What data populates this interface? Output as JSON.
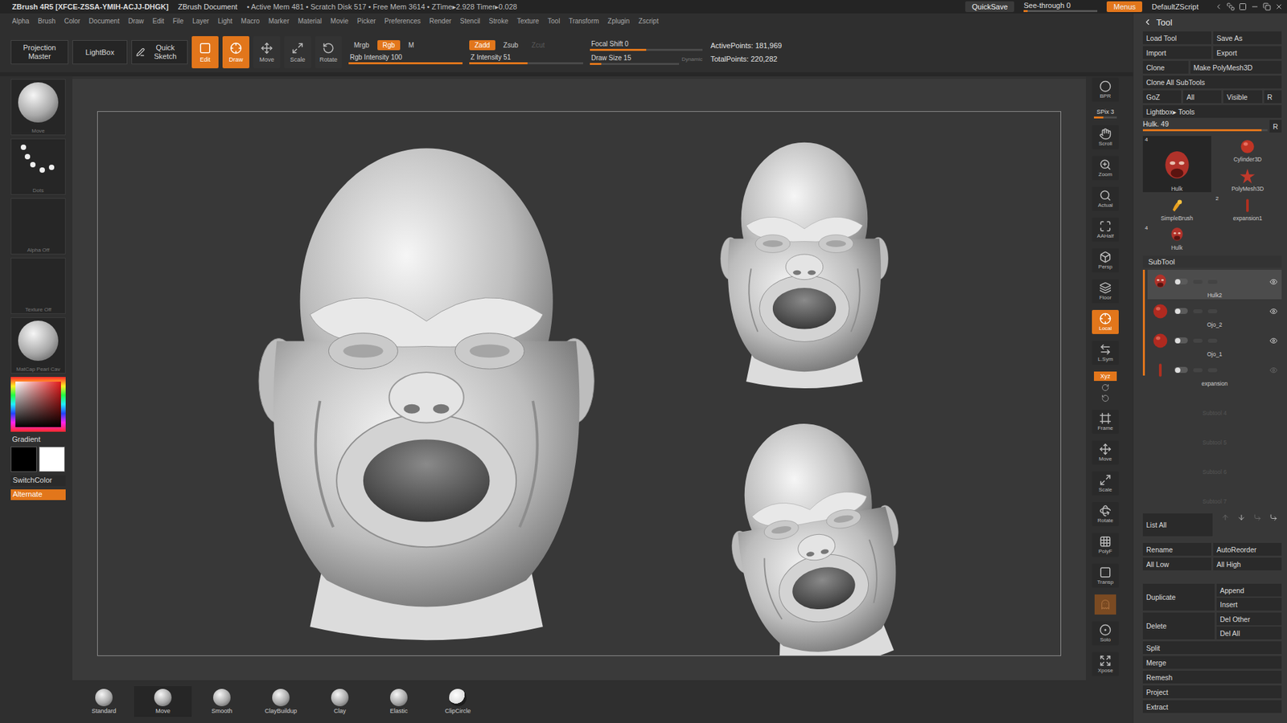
{
  "title_bar": {
    "app": "ZBrush 4R5 [XFCE-ZSSA-YMIH-ACJJ-DHGK]",
    "document": "ZBrush Document",
    "stats": "• Active Mem 481 • Scratch Disk 517 • Free Mem 3614 • ZTime▸2.928 Timer▸0.028",
    "quicksave": "QuickSave",
    "see_through": {
      "label": "See-through",
      "value": "0",
      "level": 0
    },
    "menus": {
      "label": "Menus",
      "on": true
    },
    "script": "DefaultZScript"
  },
  "menu_bar": [
    "Alpha",
    "Brush",
    "Color",
    "Document",
    "Draw",
    "Edit",
    "File",
    "Layer",
    "Light",
    "Macro",
    "Marker",
    "Material",
    "Movie",
    "Picker",
    "Preferences",
    "Render",
    "Stencil",
    "Stroke",
    "Texture",
    "Tool",
    "Transform",
    "Zplugin",
    "Zscript"
  ],
  "top_shelf": {
    "projection_master": "Projection Master",
    "lightbox": "LightBox",
    "quick_sketch": "Quick Sketch",
    "modes": [
      {
        "label": "Edit",
        "selected": true
      },
      {
        "label": "Draw",
        "selected": true
      },
      {
        "label": "Move",
        "selected": false
      },
      {
        "label": "Scale",
        "selected": false
      },
      {
        "label": "Rotate",
        "selected": false
      }
    ],
    "color_modes": [
      {
        "label": "Mrgb",
        "selected": false,
        "disabled": false
      },
      {
        "label": "Rgb",
        "selected": true,
        "disabled": false
      },
      {
        "label": "M",
        "selected": false,
        "disabled": false
      }
    ],
    "rgb_intensity": {
      "label": "Rgb Intensity",
      "value": "100",
      "level": 1
    },
    "z_modes": [
      {
        "label": "Zadd",
        "selected": true,
        "disabled": false
      },
      {
        "label": "Zsub",
        "selected": false,
        "disabled": false
      },
      {
        "label": "Zcut",
        "selected": false,
        "disabled": true
      }
    ],
    "z_intensity": {
      "label": "Z Intensity",
      "value": "51",
      "level": 0.51
    },
    "focal_shift": {
      "label": "Focal Shift",
      "value": "0",
      "level": 0.5
    },
    "draw_size": {
      "label": "Draw Size",
      "value": "15",
      "level": 0.13
    },
    "dynamic": {
      "label": "Dynamic",
      "on": false
    },
    "active_points": "ActivePoints: 181,969",
    "total_points": "TotalPoints: 220,282"
  },
  "left_shelf": {
    "tiles": [
      {
        "label": "Move",
        "kind": "brush"
      },
      {
        "label": "Dots",
        "kind": "stroke"
      },
      {
        "label": "Alpha Off",
        "kind": "alpha"
      },
      {
        "label": "Texture Off",
        "kind": "texture"
      },
      {
        "label": "MatCap Pearl Cav",
        "kind": "material"
      }
    ],
    "gradient": "Gradient",
    "switch_color": "SwitchColor",
    "alternate": {
      "label": "Alternate",
      "on": true
    }
  },
  "bottom_shelf": [
    {
      "label": "Standard",
      "selected": false
    },
    {
      "label": "Move",
      "selected": true
    },
    {
      "label": "Smooth",
      "selected": false
    },
    {
      "label": "ClayBuildup",
      "selected": false
    },
    {
      "label": "Clay",
      "selected": false
    },
    {
      "label": "Elastic",
      "selected": false
    },
    {
      "label": "ClipCircle",
      "selected": false
    }
  ],
  "right_shelf": [
    {
      "label": "BPR",
      "kind": "button",
      "on": false
    },
    {
      "label": "SPix",
      "value": "3",
      "kind": "slider",
      "on": false,
      "level": 0.4
    },
    {
      "label": "Scroll",
      "kind": "button",
      "on": false
    },
    {
      "label": "Zoom",
      "kind": "button",
      "on": false
    },
    {
      "label": "Actual",
      "kind": "button",
      "on": false
    },
    {
      "label": "AAHalf",
      "kind": "button",
      "on": false
    },
    {
      "label": "Persp",
      "kind": "button",
      "on": false
    },
    {
      "label": "Floor",
      "kind": "button",
      "on": false
    },
    {
      "label": "Local",
      "kind": "button",
      "on": true
    },
    {
      "label": "L.Sym",
      "kind": "button",
      "on": false
    },
    {
      "label": "Xyz",
      "kind": "axis",
      "on": true
    },
    {
      "label": "Frame",
      "kind": "button",
      "on": false
    },
    {
      "label": "Move",
      "kind": "button",
      "on": false
    },
    {
      "label": "Scale",
      "kind": "button",
      "on": false
    },
    {
      "label": "Rotate",
      "kind": "button",
      "on": false
    },
    {
      "label": "PolyF",
      "kind": "button",
      "on": false
    },
    {
      "label": "Transp",
      "kind": "button",
      "on": false
    },
    {
      "label": "",
      "kind": "ghost",
      "on": true
    },
    {
      "label": "Solo",
      "kind": "button",
      "on": false
    },
    {
      "label": "Xpose",
      "kind": "button",
      "on": false
    }
  ],
  "tool": {
    "title": "Tool",
    "button_rows": [
      [
        "Load Tool",
        "Save As"
      ],
      [
        "Import",
        "Export"
      ],
      [
        "Clone",
        "Make PolyMesh3D"
      ]
    ],
    "clone_all": "Clone All SubTools",
    "goz": [
      "GoZ",
      "All",
      "Visible",
      "R"
    ],
    "lightbox_tools": "Lightbox▸ Tools",
    "current": {
      "label": "Hulk.",
      "value": "49",
      "level": 0.95,
      "reset": "R"
    },
    "thumbnails": [
      {
        "label": "Hulk",
        "count": "4",
        "kind": "head",
        "selected": true
      },
      {
        "label": "Cylinder3D",
        "count": "",
        "kind": "cylinder",
        "selected": false
      },
      {
        "label": "PolyMesh3D",
        "count": "",
        "kind": "star",
        "selected": false
      },
      {
        "label": "SimpleBrush",
        "count": "",
        "kind": "brush",
        "selected": false
      },
      {
        "label": "expansion1",
        "count": "2",
        "kind": "stick",
        "selected": false
      },
      {
        "label": "Hulk",
        "count": "4",
        "kind": "head",
        "selected": false
      }
    ],
    "subtool": {
      "title": "SubTool",
      "scroll_level": 0.45,
      "items": [
        {
          "name": "Hulk2",
          "kind": "head",
          "selected": true,
          "visible": true
        },
        {
          "name": "Ojo_2",
          "kind": "sphere",
          "selected": false,
          "visible": true
        },
        {
          "name": "Ojo_1",
          "kind": "sphere",
          "selected": false,
          "visible": true
        },
        {
          "name": "expansion",
          "kind": "stick",
          "selected": false,
          "visible": false
        }
      ],
      "empty": [
        "Subtool 4",
        "Subtool 5",
        "Subtool 6",
        "Subtool 7"
      ]
    },
    "list_all": "List All",
    "actions": {
      "pairs": [
        [
          "Rename",
          "AutoReorder"
        ],
        [
          "All Low",
          "All High"
        ]
      ],
      "blocks": [
        {
          "label": "Duplicate",
          "options": [
            "Append",
            "Insert"
          ]
        },
        {
          "label": "Delete",
          "options": [
            "Del Other",
            "Del All"
          ]
        }
      ],
      "singles": [
        "Split",
        "Merge",
        "Remesh",
        "Project",
        "Extract"
      ]
    }
  }
}
